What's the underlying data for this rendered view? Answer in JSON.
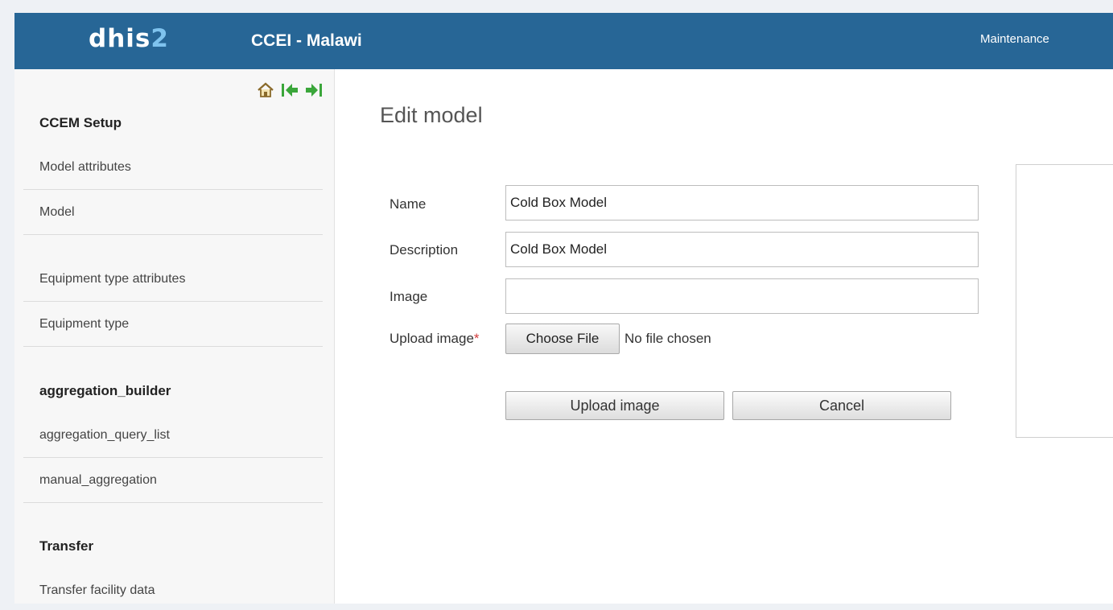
{
  "header": {
    "logo_main": "dhis",
    "logo_accent": "2",
    "title": "CCEI - Malawi",
    "maintenance_link": "Maintenance"
  },
  "colors": {
    "header_bg": "#276696",
    "nav_icon_green": "#3aa63a",
    "home_icon": "#8a6a2a"
  },
  "sidebar": {
    "nav_icons": [
      "home-icon",
      "collapse-left-icon",
      "expand-right-icon"
    ],
    "sections": [
      {
        "heading": "CCEM Setup",
        "items": [
          "Model attributes",
          "Model",
          "Equipment type attributes",
          "Equipment type"
        ]
      },
      {
        "heading": "aggregation_builder",
        "items": [
          "aggregation_query_list",
          "manual_aggregation"
        ]
      },
      {
        "heading": "Transfer",
        "items": [
          "Transfer facility data"
        ]
      }
    ]
  },
  "main": {
    "page_title": "Edit model",
    "form": {
      "name_label": "Name",
      "name_value": "Cold Box Model",
      "description_label": "Description",
      "description_value": "Cold Box Model",
      "image_label": "Image",
      "image_value": "",
      "upload_label": "Upload image",
      "required_marker": "*",
      "choose_file_label": "Choose File",
      "no_file_text": "No file chosen",
      "upload_button": "Upload image",
      "cancel_button": "Cancel"
    }
  }
}
